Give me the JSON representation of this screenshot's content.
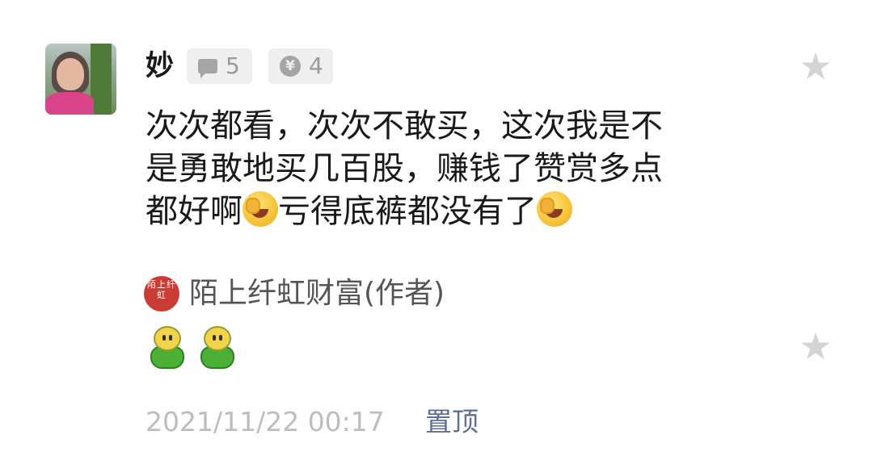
{
  "comment": {
    "author_name": "妙",
    "reply_count": "5",
    "reward_count": "4",
    "text_line1": "次次都看，次次不敢买，这次我是不",
    "text_line2": "是勇敢地买几百股，赚钱了赞赏多点",
    "text_line3a": "都好啊",
    "text_line3b": "亏得底裤都没有了",
    "emoji": "face-with-tears-of-joy",
    "star_icon": "star-icon"
  },
  "reply": {
    "avatar_text": "陌上纤虹",
    "author_name": "陌上纤虹财富(作者)",
    "content_emojis": [
      "green-smiley",
      "green-smiley"
    ]
  },
  "footer": {
    "timestamp": "2021/11/22 00:17",
    "pin_label": "置顶"
  },
  "colors": {
    "badge_bg": "#efefef",
    "muted_text": "#9a9a9a",
    "link_blue": "#5e6f93",
    "star_gray": "#d4d4d4",
    "author_avatar_red": "#c93b35"
  }
}
